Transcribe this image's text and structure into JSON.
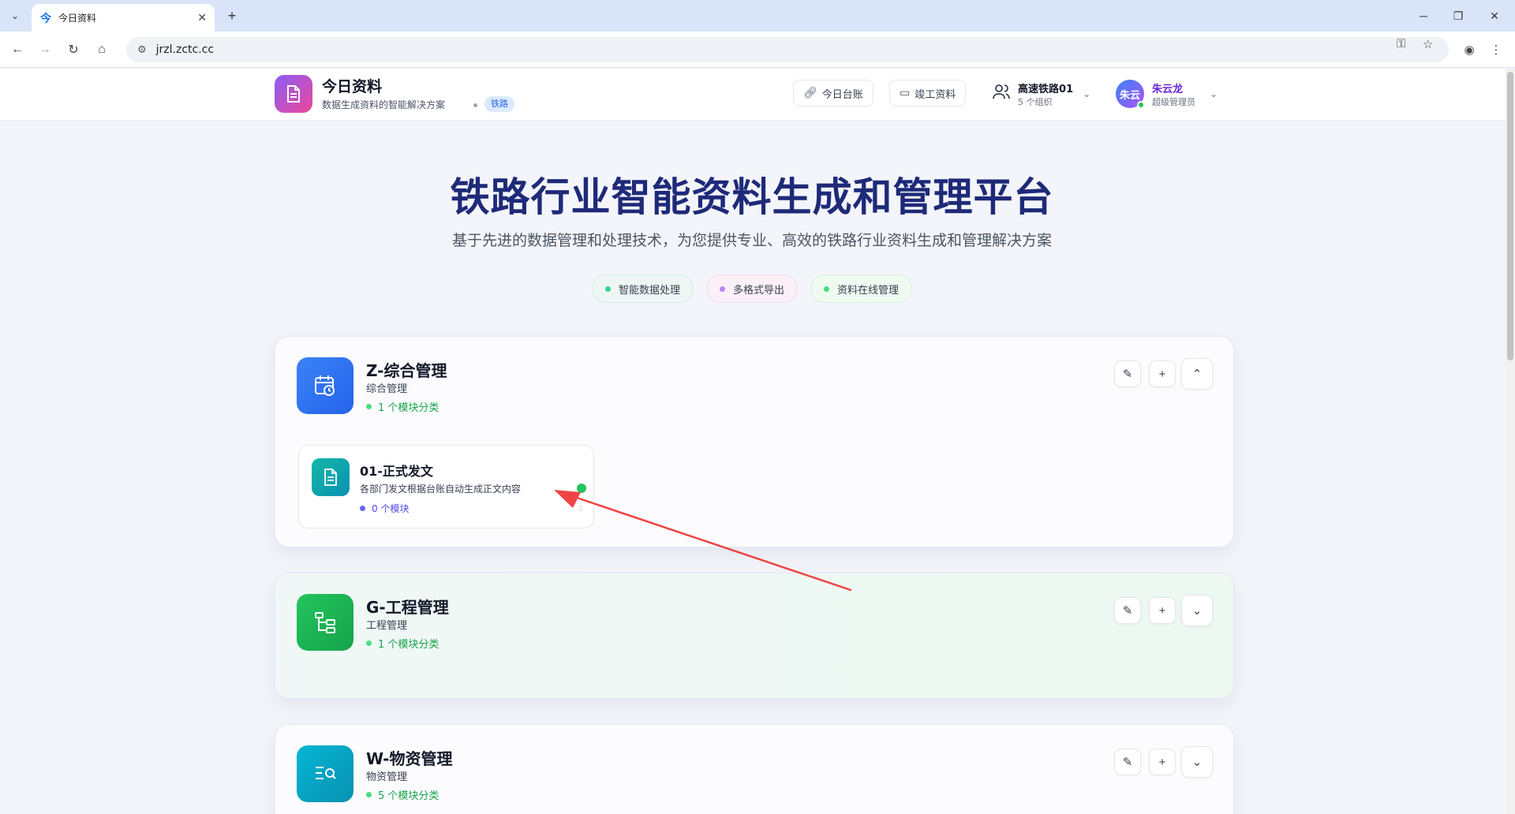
{
  "browser": {
    "tab_title": "今日资料",
    "url": "jrzl.zctc.cc"
  },
  "header": {
    "brand_title": "今日资料",
    "brand_subtitle": "数据生成资料的智能解决方案",
    "brand_tag": "铁路",
    "btn_ledger": "今日台账",
    "btn_completion": "竣工资料",
    "org_name": "高速铁路01",
    "org_count": "5 个组织",
    "user_avatar": "朱云",
    "user_name": "朱云龙",
    "user_role": "超级管理员"
  },
  "hero": {
    "title": "铁路行业智能资料生成和管理平台",
    "subtitle": "基于先进的数据管理和处理技术，为您提供专业、高效的铁路行业资料生成和管理解决方案",
    "pills": [
      "智能数据处理",
      "多格式导出",
      "资料在线管理"
    ]
  },
  "categories": [
    {
      "title": "Z-综合管理",
      "subtitle": "综合管理",
      "count": "1 个模块分类",
      "expanded": true,
      "modules": [
        {
          "title": "01-正式发文",
          "desc": "各部门发文根据台账自动生成正文内容",
          "count": "0 个模块"
        }
      ]
    },
    {
      "title": "G-工程管理",
      "subtitle": "工程管理",
      "count": "1 个模块分类",
      "expanded": false
    },
    {
      "title": "W-物资管理",
      "subtitle": "物资管理",
      "count": "5 个模块分类",
      "expanded": false
    }
  ],
  "colors": {
    "hero_title": "#1e2a78",
    "annotation_arrow": "#ef4444",
    "status_green": "#22c55e"
  }
}
